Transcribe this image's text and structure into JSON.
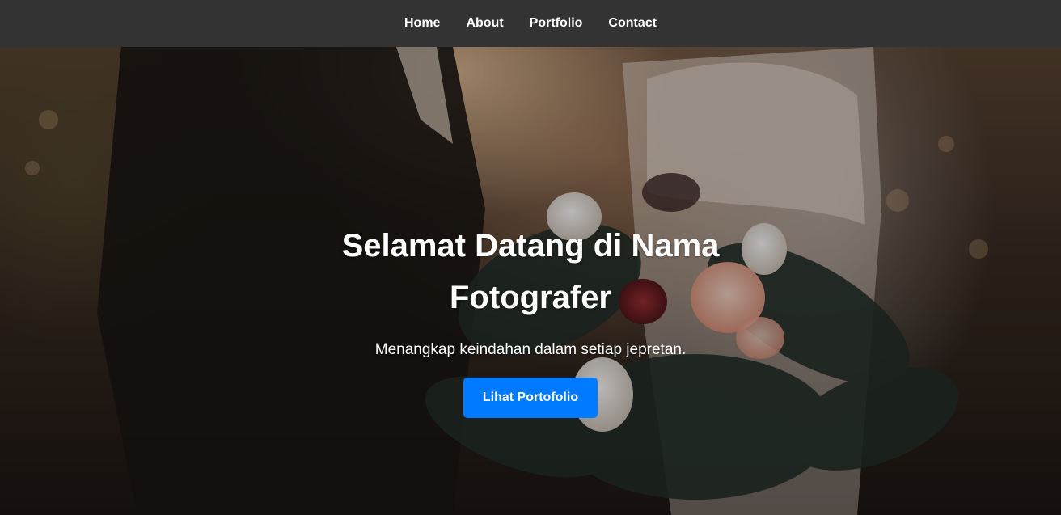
{
  "nav": {
    "items": [
      {
        "label": "Home"
      },
      {
        "label": "About"
      },
      {
        "label": "Portfolio"
      },
      {
        "label": "Contact"
      }
    ]
  },
  "hero": {
    "title": "Selamat Datang di Nama Fotografer",
    "subtitle": "Menangkap keindahan dalam setiap jepretan.",
    "button_label": "Lihat Portofolio"
  },
  "colors": {
    "navbar_bg": "#333333",
    "button_bg": "#007bff",
    "text": "#ffffff"
  }
}
